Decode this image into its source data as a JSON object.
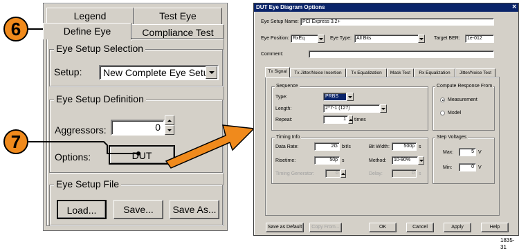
{
  "panel": {
    "tabs": {
      "legend": "Legend",
      "test_eye": "Test Eye",
      "define_eye": "Define Eye",
      "compliance_test": "Compliance Test"
    },
    "eye_setup_selection": {
      "title": "Eye Setup Selection",
      "setup_label": "Setup:",
      "setup_value": "New Complete Eye Setup"
    },
    "eye_setup_definition": {
      "title": "Eye Setup Definition",
      "aggressors_label": "Aggressors:",
      "aggressors_value": "0",
      "options_label": "Options:",
      "dut_button": "DUT"
    },
    "eye_setup_file": {
      "title": "Eye Setup File",
      "load": "Load...",
      "save": "Save...",
      "save_as": "Save As..."
    }
  },
  "callouts": {
    "step6": "6",
    "step7": "7"
  },
  "dialog": {
    "title": "DUT Eye Diagram Options",
    "close_glyph": "×",
    "eye_setup_name_label": "Eye Setup Name:",
    "eye_setup_name_value": "PCI Express 3.2+",
    "eye_position_label": "Eye Position:",
    "eye_position_value": "RxEq",
    "eye_type_label": "Eye Type:",
    "eye_type_value": "All Bits",
    "target_ber_label": "Target BER:",
    "target_ber_value": "1e-012",
    "comment_label": "Comment:",
    "comment_value": "",
    "tabs": [
      "Tx Signal",
      "Tx Jitter/Noise Insertion",
      "Tx Equalization",
      "Mask Test",
      "Rx Equalization",
      "Jitter/Noise Test"
    ],
    "sequence": {
      "title": "Sequence",
      "type_label": "Type:",
      "type_value": "PRBS",
      "length_label": "Length:",
      "length_value": "2^7-1 (127)",
      "repeat_label": "Repeat:",
      "repeat_value": "1",
      "repeat_unit": "times"
    },
    "compute": {
      "title": "Compute Response From",
      "measurement": "Measurement",
      "model": "Model",
      "selected": "Measurement"
    },
    "timing": {
      "title": "Timing Info",
      "data_rate_label": "Data Rate:",
      "data_rate_value": "2G",
      "data_rate_unit": "bit/s",
      "bit_width_label": "Bit Width:",
      "bit_width_value": "500p",
      "bit_width_unit": "s",
      "risetime_label": "Risetime:",
      "risetime_value": "50p",
      "risetime_unit": "s",
      "method_label": "Method:",
      "method_value": "10-90%",
      "timing_gen_label": "Timing Generator:",
      "timing_gen_value": "0",
      "delay_label": "Delay:",
      "delay_value": "0",
      "delay_unit": "s"
    },
    "step_voltages": {
      "title": "Step Voltages",
      "max_label": "Max:",
      "max_value": "5",
      "max_unit": "V",
      "min_label": "Min:",
      "min_value": "0",
      "min_unit": "V"
    },
    "buttons": {
      "save_default": "Save as Default",
      "copy_from": "Copy From...",
      "ok": "OK",
      "cancel": "Cancel",
      "apply": "Apply",
      "help": "Help"
    }
  },
  "figure_id": "1835-31",
  "colors": {
    "callout": "#f08a1c",
    "titlebar": "#0a246a",
    "selection": "#0a246a",
    "window": "#d4d0c8"
  }
}
